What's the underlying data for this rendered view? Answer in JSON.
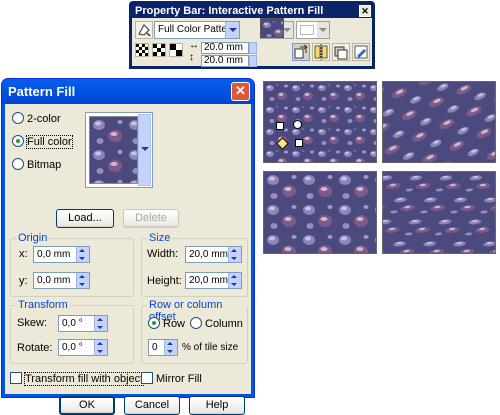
{
  "property_bar": {
    "title": "Property Bar: Interactive Pattern Fill",
    "close_glyph": "✕",
    "pattern_type": "Full Color Pattern",
    "width_value": "20.0 mm",
    "height_value": "20.0 mm",
    "icons": [
      "pattern-fill-icon",
      "pattern-tile-small-icon",
      "pattern-tile-medium-icon",
      "pattern-tile-large-icon",
      "transform-with-object-icon",
      "mirror-fill-icon",
      "copy-fill-icon",
      "edit-fill-icon"
    ]
  },
  "dialog": {
    "title": "Pattern Fill",
    "close_glyph": "✕",
    "radio_2color": "2-color",
    "radio_full_color": "Full color",
    "radio_bitmap": "Bitmap",
    "selected_type": "Full color",
    "load_button": "Load...",
    "delete_button": "Delete",
    "origin": {
      "label": "Origin",
      "x_label": "x:",
      "x_value": "0,0 mm",
      "y_label": "y:",
      "y_value": "0,0 mm"
    },
    "size": {
      "label": "Size",
      "width_label": "Width:",
      "width_value": "20,0 mm",
      "height_label": "Height:",
      "height_value": "20,0 mm"
    },
    "transform": {
      "label": "Transform",
      "skew_label": "Skew:",
      "skew_value": "0,0 °",
      "rotate_label": "Rotate:",
      "rotate_value": "0,0 °"
    },
    "offset": {
      "label": "Row or column offset",
      "row_label": "Row",
      "column_label": "Column",
      "selected": "Row",
      "value": "0",
      "unit_label": "% of tile size"
    },
    "transform_fill_checkbox": "Transform fill with object",
    "mirror_fill_checkbox": "Mirror Fill",
    "ok_button": "OK",
    "cancel_button": "Cancel",
    "help_button": "Help"
  },
  "colors": {
    "title_blue": "#0054e3",
    "dialog_face": "#ece9d8",
    "group_label": "#0046d5",
    "pattern_base": "#4f4d82"
  }
}
